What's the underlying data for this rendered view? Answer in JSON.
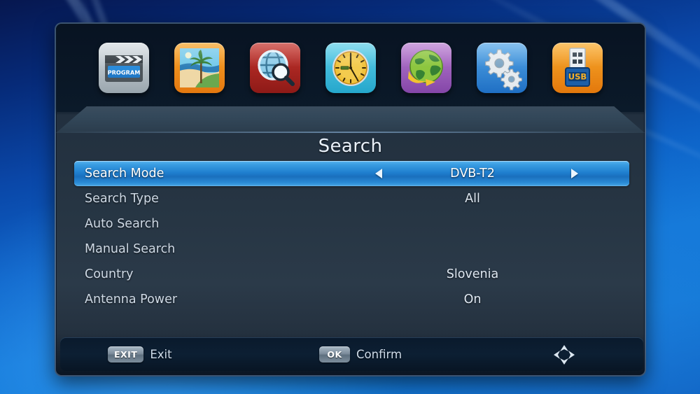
{
  "window": {
    "title": "Search"
  },
  "iconbar": {
    "items": [
      {
        "name": "program-icon",
        "label": "PROGRAM"
      },
      {
        "name": "picture-icon",
        "label": "Picture"
      },
      {
        "name": "search-icon",
        "label": "Search"
      },
      {
        "name": "time-icon",
        "label": "Time"
      },
      {
        "name": "network-icon",
        "label": "Network"
      },
      {
        "name": "setup-icon",
        "label": "Setup"
      },
      {
        "name": "usb-icon",
        "label": "USB"
      }
    ],
    "usb_badge": "USB",
    "program_badge": "PROGRAM"
  },
  "menu": {
    "rows": [
      {
        "label": "Search Mode",
        "value": "DVB-T2",
        "selected": true,
        "has_arrows": true
      },
      {
        "label": "Search Type",
        "value": "All",
        "selected": false,
        "has_arrows": false
      },
      {
        "label": "Auto Search",
        "value": "",
        "selected": false,
        "has_arrows": false
      },
      {
        "label": "Manual Search",
        "value": "",
        "selected": false,
        "has_arrows": false
      },
      {
        "label": "Country",
        "value": "Slovenia",
        "selected": false,
        "has_arrows": false
      },
      {
        "label": "Antenna Power",
        "value": "On",
        "selected": false,
        "has_arrows": false
      }
    ]
  },
  "bottombar": {
    "exit_key": "EXIT",
    "exit_text": "Exit",
    "ok_key": "OK",
    "ok_text": "Confirm",
    "navpad": "navigation-arrows-icon"
  },
  "colors": {
    "accent": "#1f7fcf",
    "highlight_top": "#5ab6ef",
    "panel_bg": "#263543",
    "desktop_blue": "#0d63c8",
    "text_primary": "#cfdae6",
    "text_selected": "#ffffff"
  }
}
